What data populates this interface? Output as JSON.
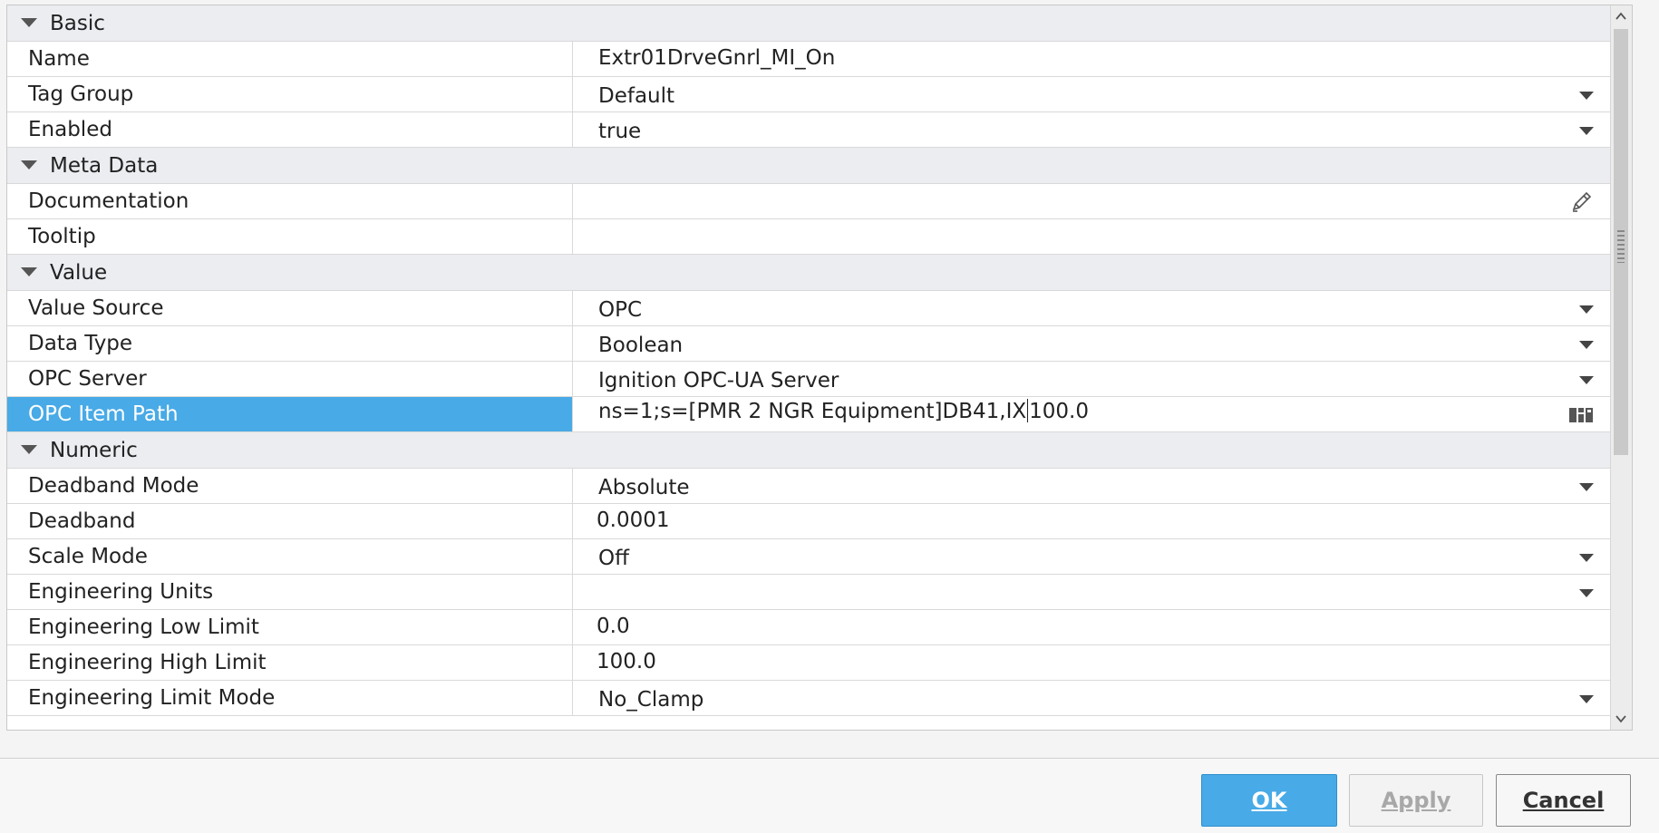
{
  "sections": {
    "basic": "Basic",
    "meta": "Meta Data",
    "value": "Value",
    "numeric": "Numeric"
  },
  "basic": {
    "name": {
      "label": "Name",
      "value": "Extr01DrveGnrl_MI_On"
    },
    "tag_group": {
      "label": "Tag Group",
      "value": "Default"
    },
    "enabled": {
      "label": "Enabled",
      "value": "true"
    }
  },
  "meta": {
    "documentation": {
      "label": "Documentation",
      "value": ""
    },
    "tooltip": {
      "label": "Tooltip",
      "value": ""
    }
  },
  "value": {
    "value_source": {
      "label": "Value Source",
      "value": "OPC"
    },
    "data_type": {
      "label": "Data Type",
      "value": "Boolean"
    },
    "opc_server": {
      "label": "OPC Server",
      "value": "Ignition OPC-UA Server"
    },
    "opc_item_path": {
      "label": "OPC Item Path",
      "value_before_cursor": "ns=1;s=[PMR 2 NGR Equipment]DB41,IX",
      "value_after_cursor": "100.0"
    }
  },
  "numeric": {
    "deadband_mode": {
      "label": "Deadband Mode",
      "value": "Absolute"
    },
    "deadband": {
      "label": "Deadband",
      "value": "0.0001"
    },
    "scale_mode": {
      "label": "Scale Mode",
      "value": "Off"
    },
    "engineering_units": {
      "label": "Engineering Units",
      "value": ""
    },
    "eng_low": {
      "label": "Engineering Low Limit",
      "value": "0.0"
    },
    "eng_high": {
      "label": "Engineering High Limit",
      "value": "100.0"
    },
    "eng_limit_mode": {
      "label": "Engineering Limit Mode",
      "value": "No_Clamp"
    }
  },
  "buttons": {
    "ok": "OK",
    "apply": "Apply",
    "cancel": "Cancel"
  },
  "colors": {
    "accent": "#48aae6",
    "section_bg": "#ebedf0",
    "grid_line": "#d9d9d9"
  },
  "icons": {
    "section_toggle": "chevron-down-icon",
    "dropdown": "caret-down-icon",
    "edit": "pencil-icon",
    "browse": "tag-browser-icon"
  }
}
